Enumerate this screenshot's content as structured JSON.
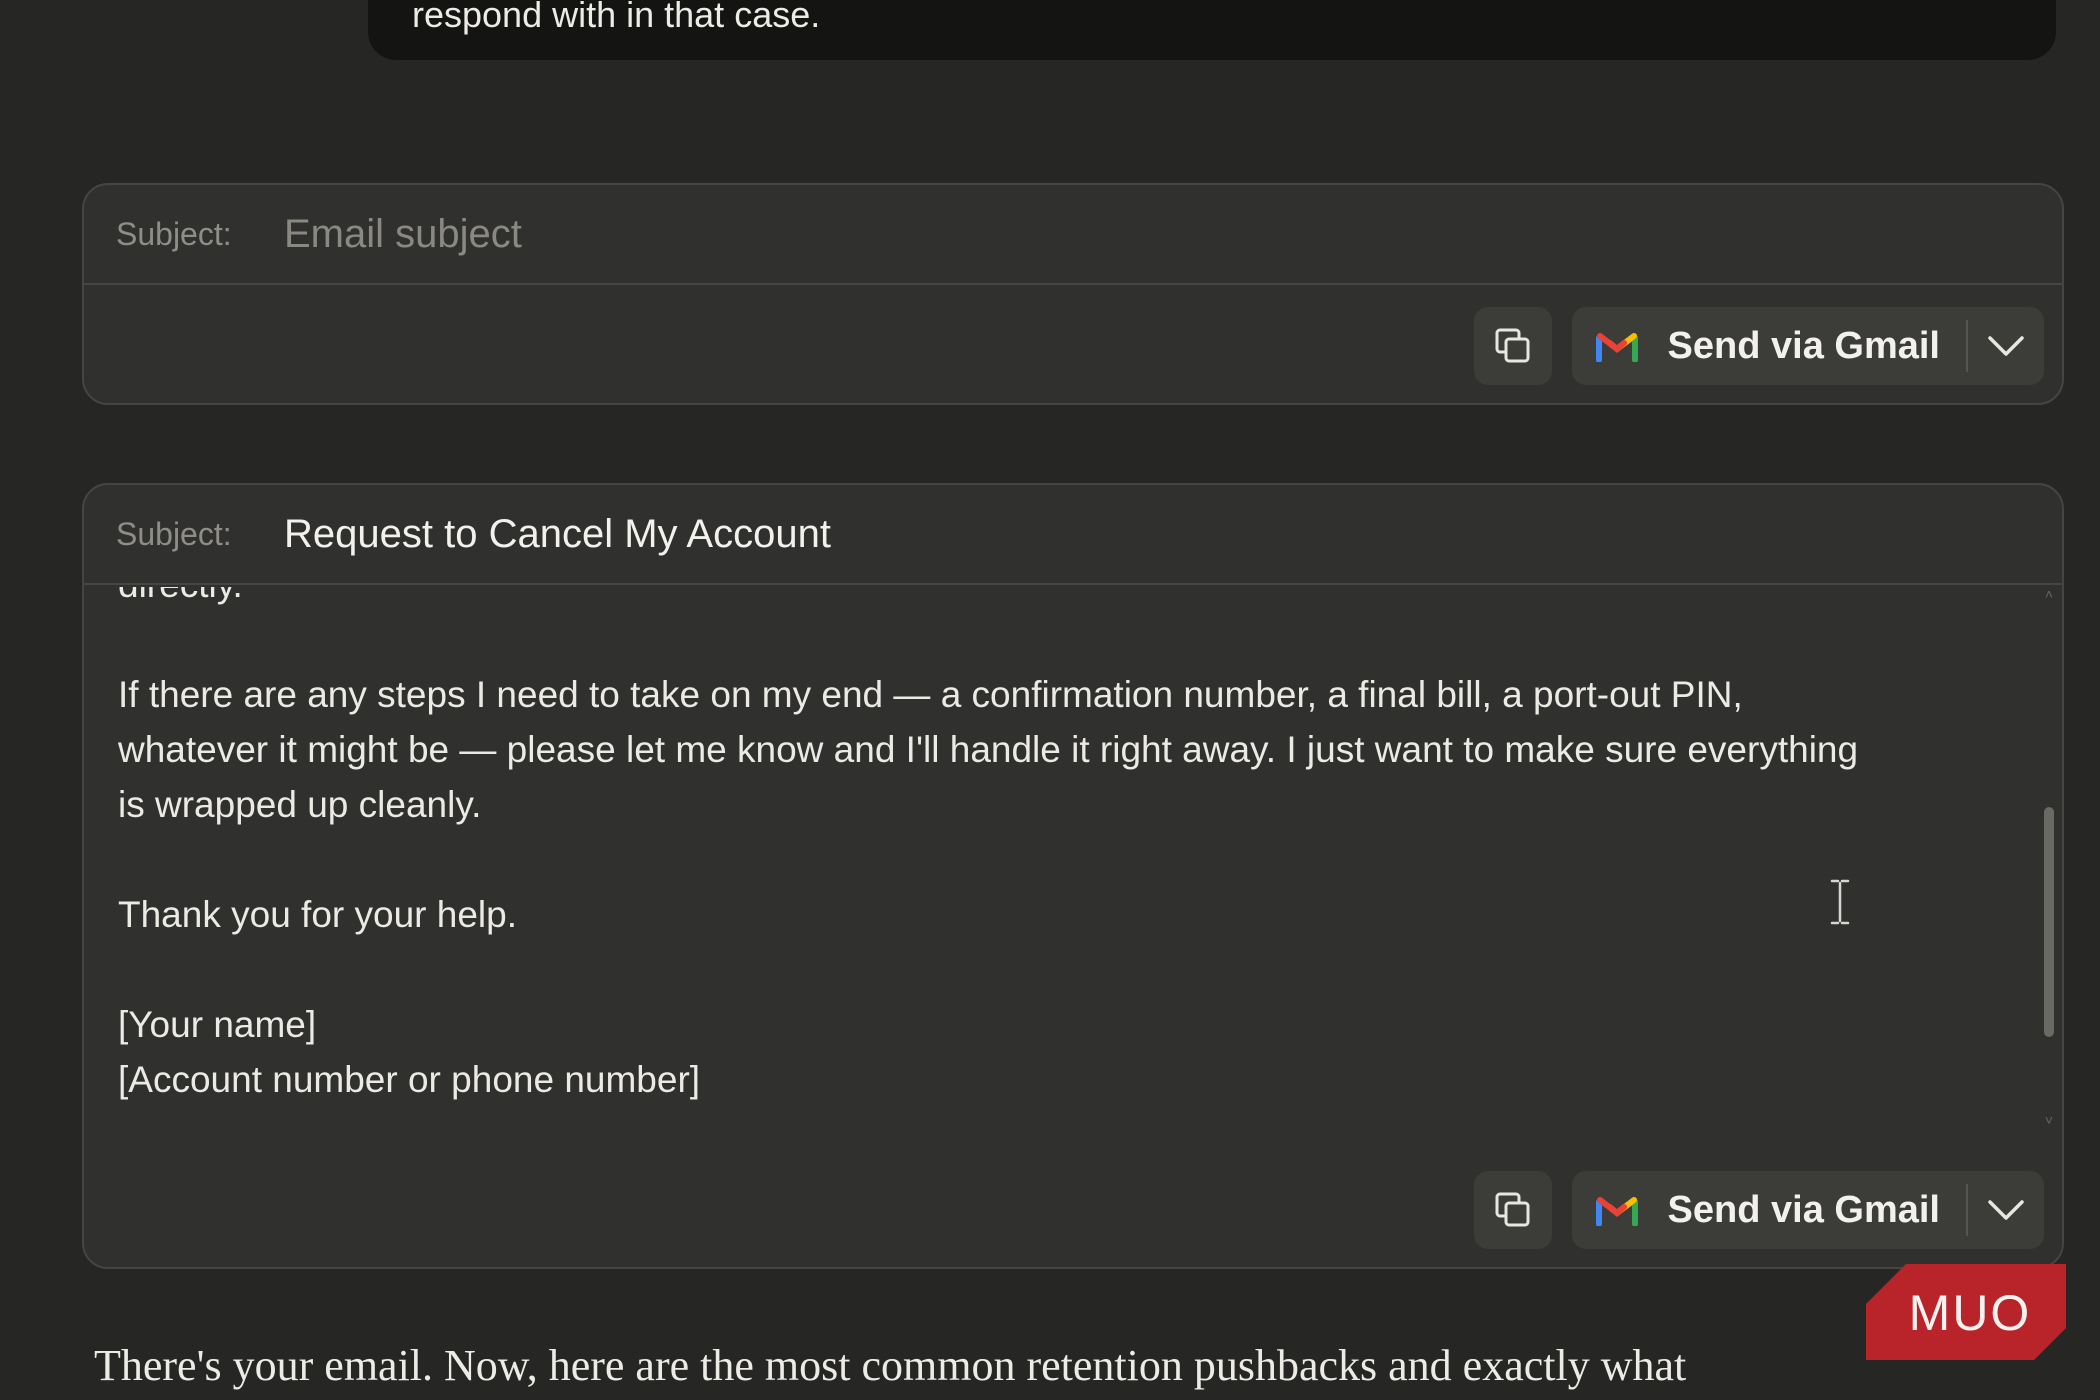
{
  "previous_message": {
    "text": "respond with in that case."
  },
  "email_draft_1": {
    "subject_label": "Subject:",
    "subject_placeholder": "Email subject",
    "subject_value": "",
    "send_label": "Send via Gmail",
    "copy_icon": "copy-icon",
    "gmail_icon": "gmail-icon",
    "dropdown_icon": "chevron-down-icon"
  },
  "email_draft_2": {
    "subject_label": "Subject:",
    "subject_value": "Request to Cancel My Account",
    "body_text": "directly.\n\nIf there are any steps I need to take on my end — a confirmation number, a final bill, a port-out PIN,\nwhatever it might be — please let me know and I'll handle it right away. I just want to make sure everything\nis wrapped up cleanly.\n\nThank you for your help.\n\n[Your name]\n[Account number or phone number]",
    "send_label": "Send via Gmail",
    "copy_icon": "copy-icon",
    "gmail_icon": "gmail-icon",
    "dropdown_icon": "chevron-down-icon"
  },
  "assistant_text": "There's your email. Now, here are the most common retention pushbacks and exactly what",
  "watermark": {
    "text": "MUO",
    "color": "#c0262d"
  },
  "colors": {
    "background": "#262624",
    "card": "#30302e",
    "bubble": "#141413",
    "button": "#3c3c39"
  }
}
